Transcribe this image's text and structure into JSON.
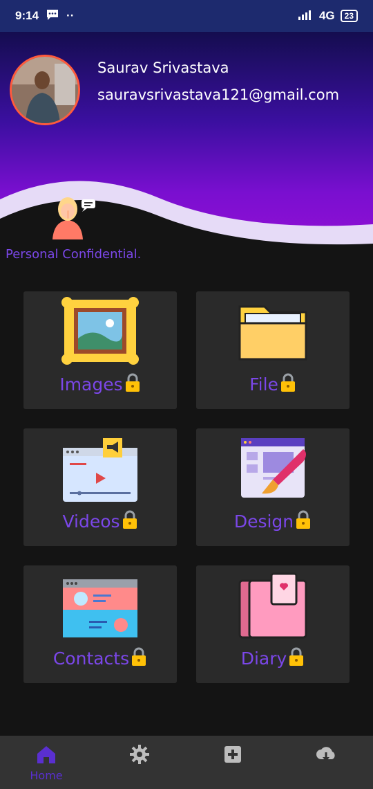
{
  "status_bar": {
    "time": "9:14",
    "network": "4G",
    "battery": "23"
  },
  "profile": {
    "name": "Saurav Srivastava",
    "email": "sauravsrivastava121@gmail.com"
  },
  "banner": {
    "label": "Personal Confidential."
  },
  "cards": [
    {
      "label": "Images",
      "icon": "picture-frame-icon"
    },
    {
      "label": "File",
      "icon": "folder-icon"
    },
    {
      "label": "Videos",
      "icon": "video-player-icon"
    },
    {
      "label": "Design",
      "icon": "design-brush-icon"
    },
    {
      "label": "Contacts",
      "icon": "contacts-card-icon"
    },
    {
      "label": "Diary",
      "icon": "diary-icon"
    }
  ],
  "bottom_nav": [
    {
      "label": "Home",
      "icon": "home-icon",
      "active": true
    },
    {
      "label": "",
      "icon": "settings-gear-icon"
    },
    {
      "label": "",
      "icon": "add-square-icon"
    },
    {
      "label": "",
      "icon": "cloud-download-icon"
    }
  ],
  "colors": {
    "accent": "#7b47e8",
    "card_bg": "#2a2a2a",
    "nav_active": "#5a2fd0"
  }
}
